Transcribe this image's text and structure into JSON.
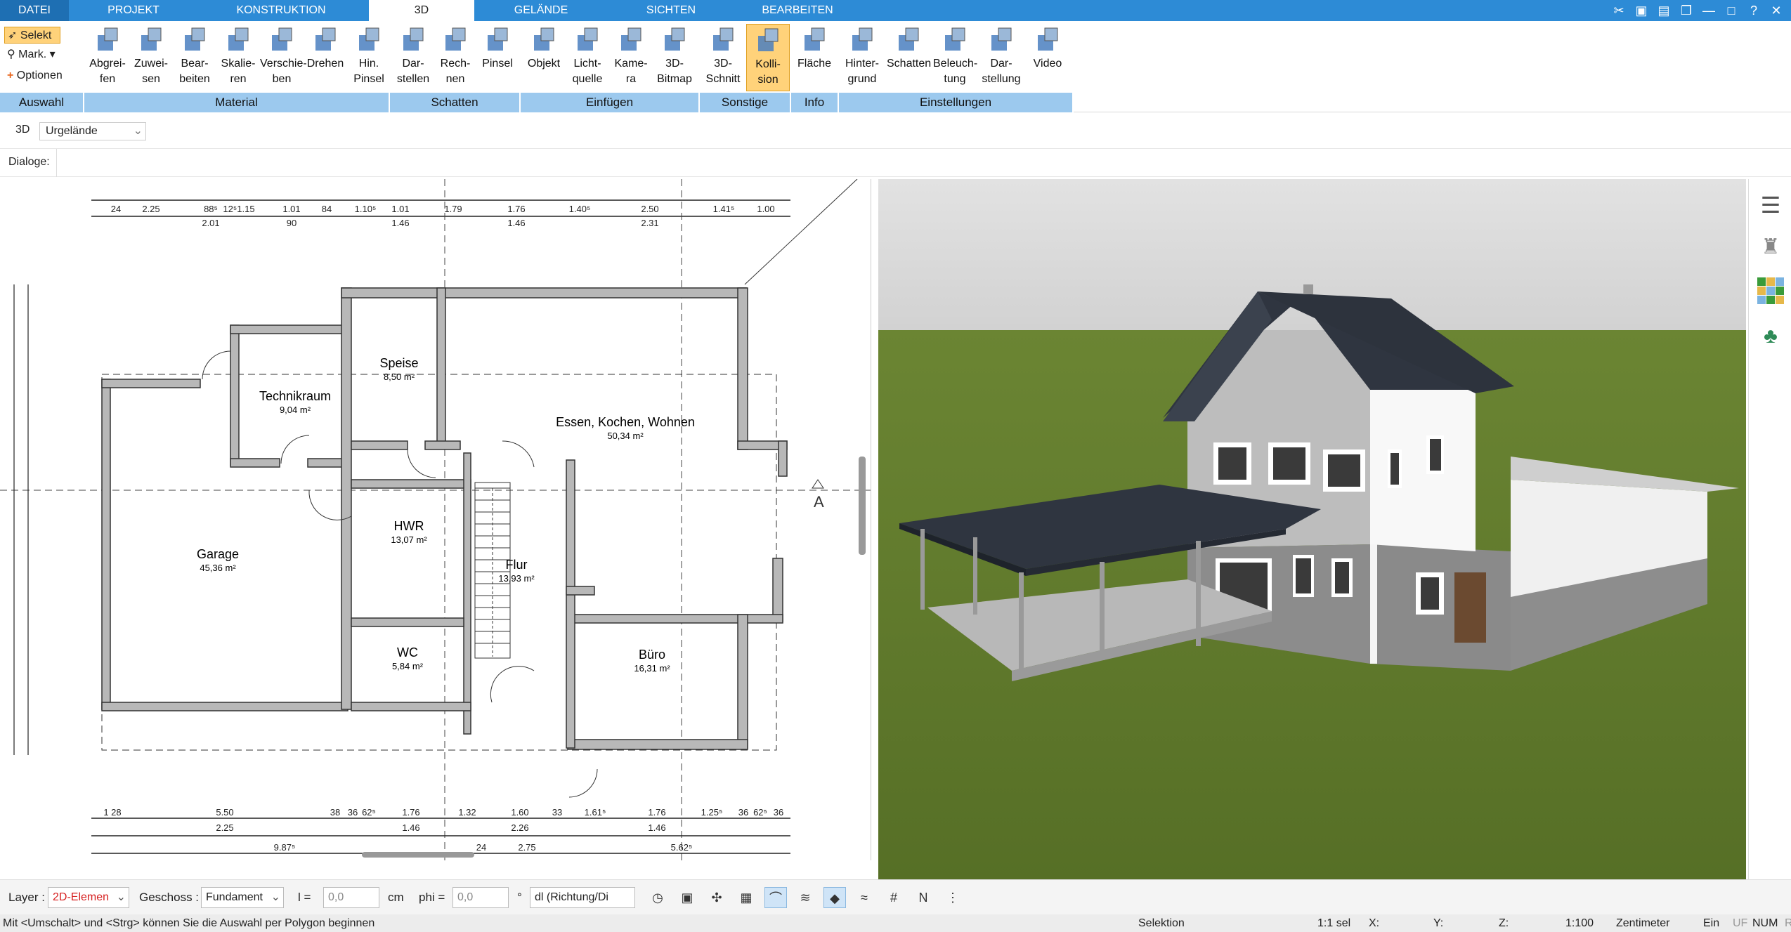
{
  "tabs": [
    "DATEI",
    "PROJEKT",
    "KONSTRUKTION",
    "3D",
    "GELÄNDE",
    "SICHTEN",
    "BEARBEITEN"
  ],
  "ribbon": {
    "auswahl": {
      "select": "Selekt",
      "mark": "Mark.",
      "options": "Optionen",
      "label": "Auswahl"
    },
    "material": {
      "label": "Material",
      "buttons": [
        [
          "Abgrei-",
          "fen"
        ],
        [
          "Zuwei-",
          "sen"
        ],
        [
          "Bear-",
          "beiten"
        ],
        [
          "Skalie-",
          "ren"
        ],
        [
          "Verschie-",
          "ben"
        ],
        [
          "Drehen",
          ""
        ],
        [
          "Hin.",
          "Pinsel"
        ]
      ]
    },
    "schatten": {
      "label": "Schatten",
      "buttons": [
        [
          "Dar-",
          "stellen"
        ],
        [
          "Rech-",
          "nen"
        ],
        [
          "Pinsel",
          ""
        ]
      ]
    },
    "einfuegen": {
      "label": "Einfügen",
      "buttons": [
        [
          "Objekt",
          ""
        ],
        [
          "Licht-",
          "quelle"
        ],
        [
          "Kame-",
          "ra"
        ],
        [
          "3D-",
          "Bitmap"
        ]
      ]
    },
    "sonstige": {
      "label": "Sonstige",
      "buttons": [
        [
          "3D-",
          "Schnitt"
        ],
        [
          "Kolli-",
          "sion"
        ]
      ]
    },
    "info": {
      "label": "Info",
      "buttons": [
        [
          "Fläche",
          ""
        ]
      ]
    },
    "einstellungen": {
      "label": "Einstellungen",
      "buttons": [
        [
          "Hinter-",
          "grund"
        ],
        [
          "Schatten",
          ""
        ],
        [
          "Beleuch-",
          "tung"
        ],
        [
          "Dar-",
          "stellung"
        ],
        [
          "Video",
          ""
        ]
      ]
    }
  },
  "viewbar": {
    "mode": "3D",
    "terrain": "Urgelände"
  },
  "dialoge": "Dialoge:",
  "plan": {
    "rooms": [
      {
        "name": "Technikraum",
        "area": "9,04 m²"
      },
      {
        "name": "Speise",
        "area": "8,50 m²"
      },
      {
        "name": "Essen, Kochen, Wohnen",
        "area": "50,34 m²"
      },
      {
        "name": "HWR",
        "area": "13,07 m²"
      },
      {
        "name": "Garage",
        "area": "45,36 m²"
      },
      {
        "name": "Flur",
        "area": "13,93 m²"
      },
      {
        "name": "WC",
        "area": "5,84 m²"
      },
      {
        "name": "Büro",
        "area": "16,31 m²"
      }
    ],
    "top_dims_row1": [
      "24",
      "2.25",
      "88⁵",
      "12⁵1.15",
      "1.01",
      "84",
      "1.10⁵",
      "1.01",
      "1.79",
      "1.76",
      "1.40⁵",
      "2.50",
      "1.41⁵",
      "1.00"
    ],
    "top_dims_row2": [
      "2.01",
      "90",
      "1.46",
      "1.46",
      "2.31"
    ],
    "bottom_dims_row1": [
      "1 28",
      "5.50",
      "38",
      "36",
      "62⁵",
      "1.76",
      "1.32",
      "1.60",
      "33",
      "1.61⁵",
      "1.76",
      "1.25⁵",
      "36",
      "62⁵",
      "36"
    ],
    "bottom_dims_row2": [
      "2.25",
      "1.46",
      "2.26",
      "1.46"
    ],
    "bottom_dims_row3": [
      "9.87⁵",
      "24",
      "2.75",
      "5.62⁵"
    ],
    "section_marker": "A"
  },
  "status": {
    "layer_label": "Layer :",
    "layer_value": "2D-Elemen",
    "floor_label": "Geschoss :",
    "floor_value": "Fundament",
    "l_label": "l =",
    "l_value": "0,0",
    "unit": "cm",
    "phi_label": "phi =",
    "phi_value": "0,0",
    "deg": "°",
    "dl_value": "dl (Richtung/Di"
  },
  "bottom": {
    "hint": "Mit <Umschalt> und <Strg> können Sie die Auswahl per Polygon beginnen",
    "mode": "Selektion",
    "sel": "1:1 sel",
    "x": "X:",
    "y": "Y:",
    "z": "Z:",
    "scale": "1:100",
    "unit": "Zentimeter",
    "ein": "Ein",
    "uf": "UF",
    "num": "NUM",
    "r": "R"
  },
  "colors": {
    "accent": "#2d8bd6",
    "group": "#9cc9ee",
    "grass": "#5f7a2d",
    "sky": "#e4e4e4",
    "roof": "#2f3540"
  }
}
